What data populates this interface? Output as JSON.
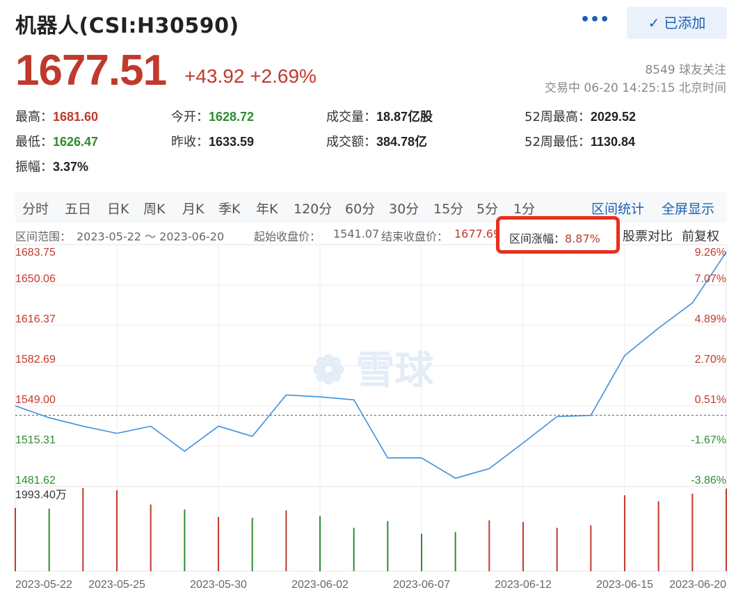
{
  "header": {
    "title": "机器人(CSI:H30590)",
    "more_label": "•••",
    "added_label": "已添加",
    "price": "1677.51",
    "change": "+43.92 +2.69%",
    "followers": "8549 球友关注",
    "trade_time": "交易中 06-20 14:25:15 北京时间"
  },
  "stats": [
    {
      "label": "最高：",
      "value": "1681.60",
      "tone": "red"
    },
    {
      "label": "今开：",
      "value": "1628.72",
      "tone": "green"
    },
    {
      "label": "成交量：",
      "value": "18.87亿股",
      "tone": "dark"
    },
    {
      "label": "52周最高：",
      "value": "2029.52",
      "tone": "dark"
    },
    {
      "label": "最低：",
      "value": "1626.47",
      "tone": "green"
    },
    {
      "label": "昨收：",
      "value": "1633.59",
      "tone": "dark"
    },
    {
      "label": "成交额：",
      "value": "384.78亿",
      "tone": "dark"
    },
    {
      "label": "52周最低：",
      "value": "1130.84",
      "tone": "dark"
    },
    {
      "label": "振幅：",
      "value": "3.37%",
      "tone": "dark"
    }
  ],
  "tabs": [
    "分时",
    "五日",
    "日K",
    "周K",
    "月K",
    "季K",
    "年K",
    "120分",
    "60分",
    "30分",
    "15分",
    "5分",
    "1分"
  ],
  "tab_links": [
    "区间统计",
    "全屏显示"
  ],
  "range": {
    "range_label": "区间范围：",
    "range_value": "2023-05-22 ～ 2023-06-20",
    "start_label": "起始收盘价：",
    "start_value": "1541.07",
    "end_label": "结束收盘价：",
    "end_value": "1677.69",
    "pct_label": "区间涨幅：",
    "pct_value": "8.87%",
    "compare_label": "股票对比",
    "adjust_label": "前复权"
  },
  "colors": {
    "up": "#c0392b",
    "down": "#2e8b2e",
    "line": "#3d8fe0",
    "box": "#e8301c",
    "link": "#1a5fb4"
  },
  "chart_data": {
    "type": "line",
    "y_ticks": [
      "1683.75",
      "1650.06",
      "1616.37",
      "1582.69",
      "1549.00",
      "1515.31",
      "1481.62"
    ],
    "pct_ticks": [
      "9.26%",
      "7.07%",
      "4.89%",
      "2.70%",
      "0.51%",
      "-1.67%",
      "-3.86%"
    ],
    "ylim": [
      1481.62,
      1683.75
    ],
    "base_close": 1541.07,
    "x_dates": [
      "2023-05-22",
      "2023-05-23",
      "2023-05-24",
      "2023-05-25",
      "2023-05-26",
      "2023-05-29",
      "2023-05-30",
      "2023-05-31",
      "2023-06-01",
      "2023-06-02",
      "2023-06-05",
      "2023-06-06",
      "2023-06-07",
      "2023-06-08",
      "2023-06-09",
      "2023-06-12",
      "2023-06-13",
      "2023-06-14",
      "2023-06-15",
      "2023-06-16",
      "2023-06-19",
      "2023-06-20"
    ],
    "close": [
      1549.0,
      1539.0,
      1532.0,
      1526.0,
      1532.0,
      1511.0,
      1532.0,
      1523.5,
      1558.0,
      1556.5,
      1554.0,
      1505.5,
      1505.5,
      1488.5,
      1496.5,
      1518.0,
      1540.0,
      1541.0,
      1591.0,
      1614.0,
      1635.0,
      1677.5
    ],
    "volume_up": [
      true,
      false,
      true,
      true,
      true,
      false,
      true,
      false,
      true,
      false,
      false,
      false,
      false,
      false,
      true,
      true,
      true,
      true,
      true,
      true,
      true,
      true
    ],
    "volume_rel": [
      0.76,
      0.75,
      1.0,
      0.97,
      0.8,
      0.74,
      0.65,
      0.64,
      0.73,
      0.66,
      0.52,
      0.6,
      0.45,
      0.47,
      0.61,
      0.59,
      0.52,
      0.55,
      0.91,
      0.84,
      0.93,
      0.99
    ],
    "volume_max_label": "1993.40万",
    "x_tick_labels": [
      "2023-05-22",
      "2023-05-25",
      "2023-05-30",
      "2023-06-02",
      "2023-06-07",
      "2023-06-12",
      "2023-06-15",
      "2023-06-20"
    ],
    "x_tick_index": [
      0,
      3,
      6,
      9,
      12,
      15,
      18,
      21
    ]
  }
}
